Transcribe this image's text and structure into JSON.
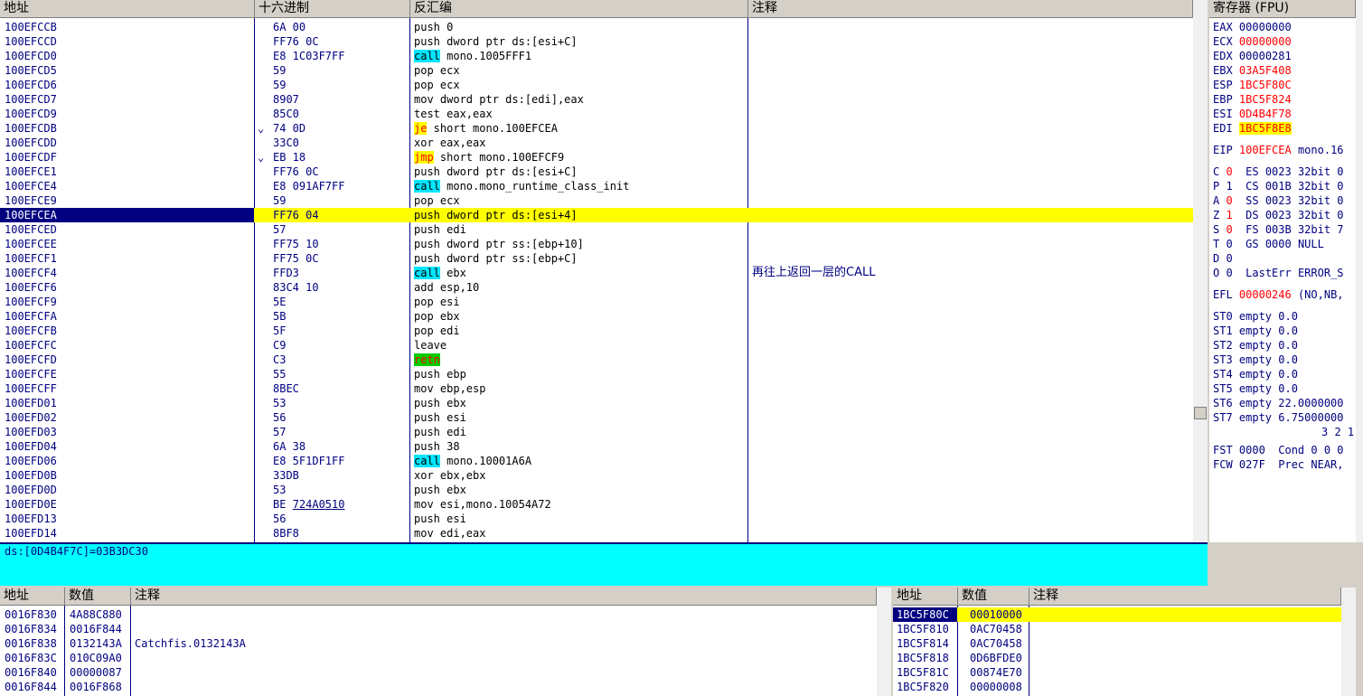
{
  "disasm": {
    "headers": {
      "address": "地址",
      "hex": "十六进制",
      "disasm": "反汇编",
      "comment": "注释"
    },
    "rows": [
      {
        "addr": "100EFCCB",
        "hex": "6A 00",
        "ins": "push 0"
      },
      {
        "addr": "100EFCCD",
        "hex": "FF76 0C",
        "ins": "push dword ptr ds:[esi+C]"
      },
      {
        "addr": "100EFCD0",
        "hex": "E8 1C03F7FF",
        "mn": "call",
        "ops": " mono.1005FFF1",
        "style": "call"
      },
      {
        "addr": "100EFCD5",
        "hex": "59",
        "ins": "pop ecx"
      },
      {
        "addr": "100EFCD6",
        "hex": "59",
        "ins": "pop ecx"
      },
      {
        "addr": "100EFCD7",
        "hex": "8907",
        "ins": "mov dword ptr ds:[edi],eax"
      },
      {
        "addr": "100EFCD9",
        "hex": "85C0",
        "ins": "test eax,eax"
      },
      {
        "addr": "100EFCDB",
        "hex": "74 0D",
        "mn": "je",
        "ops": " short mono.100EFCEA",
        "style": "jmp",
        "arrow": "⌄"
      },
      {
        "addr": "100EFCDD",
        "hex": "33C0",
        "ins": "xor eax,eax"
      },
      {
        "addr": "100EFCDF",
        "hex": "EB 18",
        "mn": "jmp",
        "ops": " short mono.100EFCF9",
        "style": "jmp",
        "arrow": "⌄"
      },
      {
        "addr": "100EFCE1",
        "hex": "FF76 0C",
        "ins": "push dword ptr ds:[esi+C]"
      },
      {
        "addr": "100EFCE4",
        "hex": "E8 091AF7FF",
        "mn": "call",
        "ops": " mono.mono_runtime_class_init",
        "style": "call"
      },
      {
        "addr": "100EFCE9",
        "hex": "59",
        "ins": "pop ecx"
      },
      {
        "addr": "100EFCEA",
        "hex": "FF76 04",
        "ins": "push dword ptr ds:[esi+4]",
        "selected": true
      },
      {
        "addr": "100EFCED",
        "hex": "57",
        "ins": "push edi"
      },
      {
        "addr": "100EFCEE",
        "hex": "FF75 10",
        "ins": "push dword ptr ss:[ebp+10]"
      },
      {
        "addr": "100EFCF1",
        "hex": "FF75 0C",
        "ins": "push dword ptr ss:[ebp+C]"
      },
      {
        "addr": "100EFCF4",
        "hex": "FFD3",
        "mn": "call",
        "ops": " ebx",
        "style": "call",
        "comment": "再往上返回一层的CALL"
      },
      {
        "addr": "100EFCF6",
        "hex": "83C4 10",
        "ins": "add esp,10"
      },
      {
        "addr": "100EFCF9",
        "hex": "5E",
        "ins": "pop esi"
      },
      {
        "addr": "100EFCFA",
        "hex": "5B",
        "ins": "pop ebx"
      },
      {
        "addr": "100EFCFB",
        "hex": "5F",
        "ins": "pop edi"
      },
      {
        "addr": "100EFCFC",
        "hex": "C9",
        "ins": "leave"
      },
      {
        "addr": "100EFCFD",
        "hex": "C3",
        "mn": "retn",
        "ops": "",
        "style": "ret"
      },
      {
        "addr": "100EFCFE",
        "hex": "55",
        "ins": "push ebp"
      },
      {
        "addr": "100EFCFF",
        "hex": "8BEC",
        "ins": "mov ebp,esp"
      },
      {
        "addr": "100EFD01",
        "hex": "53",
        "ins": "push ebx"
      },
      {
        "addr": "100EFD02",
        "hex": "56",
        "ins": "push esi"
      },
      {
        "addr": "100EFD03",
        "hex": "57",
        "ins": "push edi"
      },
      {
        "addr": "100EFD04",
        "hex": "6A 38",
        "ins": "push 38"
      },
      {
        "addr": "100EFD06",
        "hex": "E8 5F1DF1FF",
        "mn": "call",
        "ops": " mono.10001A6A",
        "style": "call"
      },
      {
        "addr": "100EFD0B",
        "hex": "33DB",
        "ins": "xor ebx,ebx"
      },
      {
        "addr": "100EFD0D",
        "hex": "53",
        "ins": "push ebx"
      },
      {
        "addr": "100EFD0E",
        "hex": "BE 724A0510",
        "ins": "mov esi,mono.10054A72",
        "underline_hex": "724A0510"
      },
      {
        "addr": "100EFD13",
        "hex": "56",
        "ins": "push esi"
      },
      {
        "addr": "100EFD14",
        "hex": "8BF8",
        "ins": "mov edi,eax"
      }
    ]
  },
  "info_line": "ds:[0D4B4F7C]=03B3DC30",
  "registers": {
    "title": "寄存器 (FPU)",
    "gpr": [
      {
        "name": "EAX",
        "val": "00000000",
        "color": "navy"
      },
      {
        "name": "ECX",
        "val": "00000000",
        "color": "red"
      },
      {
        "name": "EDX",
        "val": "00000281",
        "color": "navy"
      },
      {
        "name": "EBX",
        "val": "03A5F408",
        "color": "red"
      },
      {
        "name": "ESP",
        "val": "1BC5F80C",
        "color": "red"
      },
      {
        "name": "EBP",
        "val": "1BC5F824",
        "color": "red"
      },
      {
        "name": "ESI",
        "val": "0D4B4F78",
        "color": "red"
      },
      {
        "name": "EDI",
        "val": "1BC5F8E8",
        "color": "red",
        "highlight": true
      }
    ],
    "eip": {
      "name": "EIP",
      "val": "100EFCEA",
      "extra": "mono.16"
    },
    "flags": [
      {
        "f": "C",
        "v": "0",
        "seg": "ES 0023 32bit 0",
        "hi": true
      },
      {
        "f": "P",
        "v": "1",
        "seg": "CS 001B 32bit 0",
        "hi": false
      },
      {
        "f": "A",
        "v": "0",
        "seg": "SS 0023 32bit 0",
        "hi": true
      },
      {
        "f": "Z",
        "v": "1",
        "seg": "DS 0023 32bit 0",
        "hi": true
      },
      {
        "f": "S",
        "v": "0",
        "seg": "FS 003B 32bit 7",
        "hi": true
      },
      {
        "f": "T",
        "v": "0",
        "seg": "GS 0000 NULL",
        "hi": false
      },
      {
        "f": "D",
        "v": "0",
        "seg": "",
        "hi": false
      },
      {
        "f": "O",
        "v": "0",
        "seg": "LastErr ERROR_S",
        "hi": false
      }
    ],
    "efl": {
      "name": "EFL",
      "val": "00000246",
      "extra": "(NO,NB,"
    },
    "fpu": [
      "ST0 empty 0.0",
      "ST1 empty 0.0",
      "ST2 empty 0.0",
      "ST3 empty 0.0",
      "ST4 empty 0.0",
      "ST5 empty 0.0",
      "ST6 empty 22.0000000",
      "ST7 empty 6.75000000"
    ],
    "fpu_bits": "3 2 1",
    "fst": "FST 0000  Cond 0 0 0",
    "fcw": "FCW 027F  Prec NEAR,"
  },
  "dump": {
    "headers": {
      "address": "地址",
      "value": "数值",
      "comment": "注释"
    },
    "rows": [
      {
        "addr": "0016F830",
        "val": "4A88C880",
        "comment": ""
      },
      {
        "addr": "0016F834",
        "val": "0016F844",
        "comment": ""
      },
      {
        "addr": "0016F838",
        "val": "0132143A",
        "comment": "Catchfis.0132143A"
      },
      {
        "addr": "0016F83C",
        "val": "010C09A0",
        "comment": ""
      },
      {
        "addr": "0016F840",
        "val": "00000087",
        "comment": ""
      },
      {
        "addr": "0016F844",
        "val": "0016F868",
        "comment": ""
      }
    ]
  },
  "stack": {
    "headers": {
      "address": "地址",
      "value": "数值",
      "comment": "注释"
    },
    "rows": [
      {
        "addr": "1BC5F80C",
        "val": "00010000",
        "selected": true
      },
      {
        "addr": "1BC5F810",
        "val": "0AC70458"
      },
      {
        "addr": "1BC5F814",
        "val": "0AC70458"
      },
      {
        "addr": "1BC5F818",
        "val": "0D6BFDE0"
      },
      {
        "addr": "1BC5F81C",
        "val": "00874E70"
      },
      {
        "addr": "1BC5F820",
        "val": "00000008"
      }
    ]
  }
}
